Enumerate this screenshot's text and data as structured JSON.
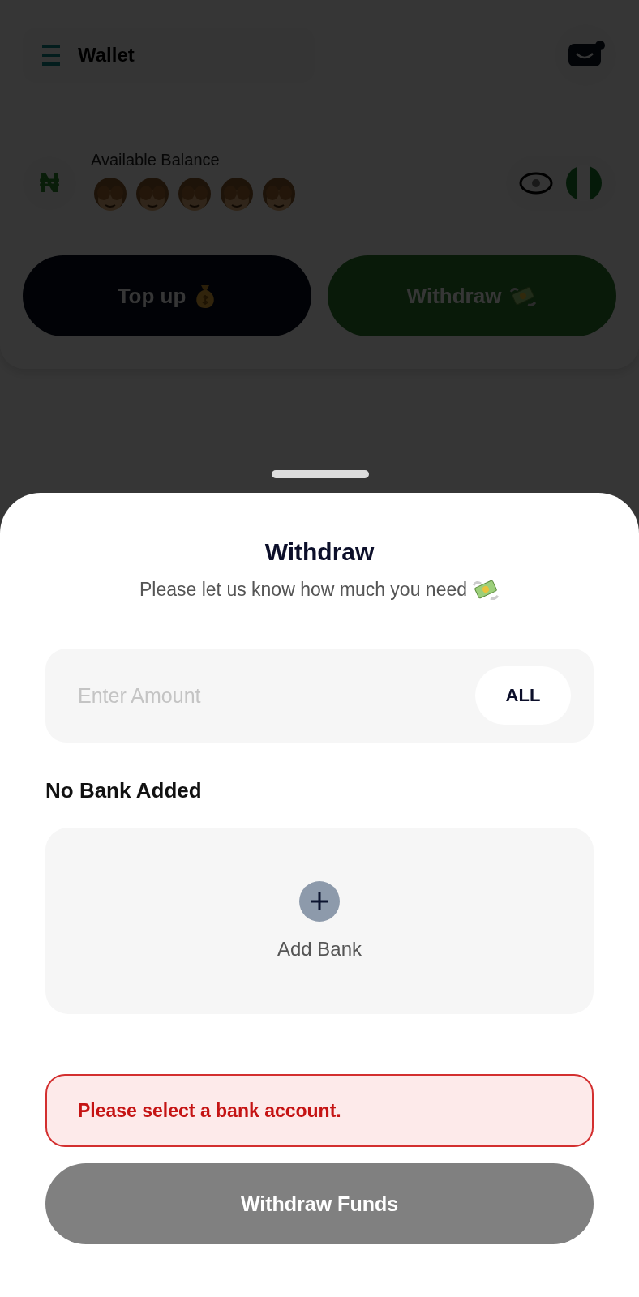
{
  "header": {
    "title": "Wallet",
    "notification_dot": true
  },
  "balance": {
    "label": "Available Balance",
    "currency_symbol": "₦",
    "hidden": true
  },
  "actions": [
    {
      "label": "Top up",
      "kind": "topup"
    },
    {
      "label": "Withdraw",
      "kind": "withdraw"
    }
  ],
  "sheet": {
    "title": "Withdraw",
    "subtitle": "Please let us know how much you need",
    "amount": {
      "placeholder": "Enter Amount"
    },
    "all_button": "ALL",
    "bank_section_label": "No Bank Added",
    "add_bank": "Add Bank",
    "error": "Please select a bank account.",
    "submit": {
      "label": "Withdraw Funds",
      "disabled": true
    }
  }
}
